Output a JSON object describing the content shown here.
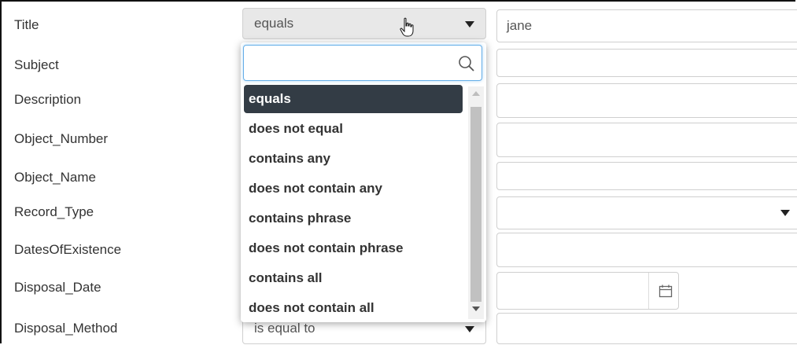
{
  "fields": [
    {
      "label": "Title"
    },
    {
      "label": "Subject"
    },
    {
      "label": "Description"
    },
    {
      "label": "Object_Number"
    },
    {
      "label": "Object_Name"
    },
    {
      "label": "Record_Type"
    },
    {
      "label": "DatesOfExistence"
    },
    {
      "label": "Disposal_Date"
    },
    {
      "label": "Disposal_Method"
    }
  ],
  "title_row": {
    "operator": "equals",
    "value": "jane"
  },
  "disposal_method_row": {
    "operator": "is equal to"
  },
  "dropdown": {
    "search_value": "",
    "options": [
      {
        "label": "equals",
        "selected": true
      },
      {
        "label": "does not equal"
      },
      {
        "label": "contains any"
      },
      {
        "label": "does not contain any"
      },
      {
        "label": "contains phrase"
      },
      {
        "label": "does not contain phrase"
      },
      {
        "label": "contains all"
      },
      {
        "label": "does not contain all"
      }
    ]
  },
  "icons": {
    "search": "search-icon",
    "calendar": "calendar-icon",
    "cursor": "hand-pointer-icon"
  },
  "colors": {
    "selected_bg": "#333c45",
    "focus_border": "#66afe9"
  }
}
